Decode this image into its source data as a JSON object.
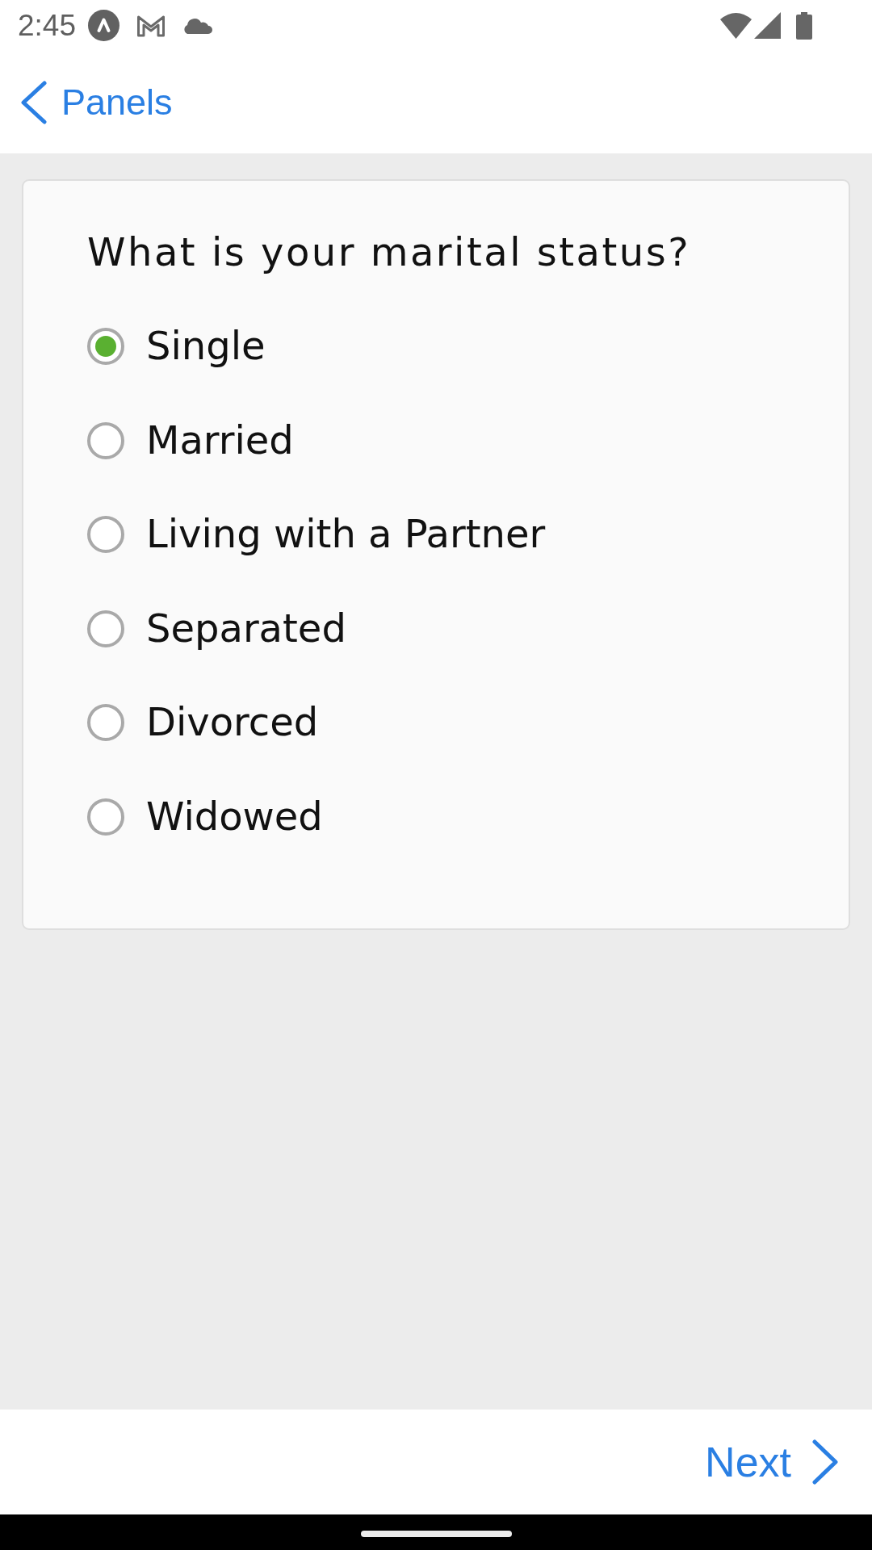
{
  "status_bar": {
    "time": "2:45"
  },
  "header": {
    "back_label": "Panels"
  },
  "question": {
    "title": "What is your marital status?",
    "options": [
      {
        "label": "Single",
        "selected": true
      },
      {
        "label": "Married",
        "selected": false
      },
      {
        "label": "Living with a Partner",
        "selected": false
      },
      {
        "label": "Separated",
        "selected": false
      },
      {
        "label": "Divorced",
        "selected": false
      },
      {
        "label": "Widowed",
        "selected": false
      }
    ]
  },
  "footer": {
    "next_label": "Next"
  }
}
